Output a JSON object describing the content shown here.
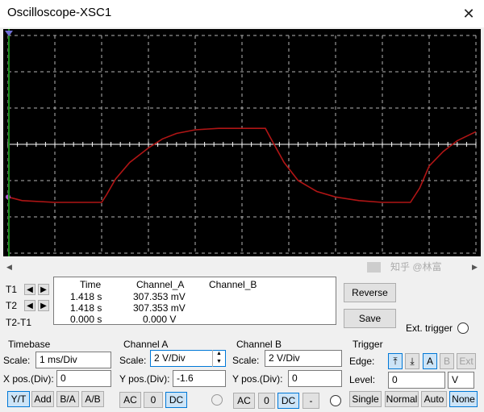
{
  "window": {
    "title": "Oscilloscope-XSC1",
    "close_glyph": "✕"
  },
  "scope": {
    "background": "#000000",
    "grid_color": "#b4b4b4",
    "trace_color": "#b01515",
    "cursor1_color": "#1a8c1a",
    "cursor2_color": "#6f6fd8",
    "divisions_x": 10,
    "divisions_y": 6,
    "volts_per_div": 2,
    "ypos_div": -1.6
  },
  "chart_data": {
    "type": "line",
    "xlim": [
      0,
      10
    ],
    "ylim": [
      -3,
      3
    ],
    "series": [
      {
        "x": [
          0,
          0.3,
          1,
          2,
          2.1,
          2.3,
          2.6,
          3.0,
          3.3,
          3.6,
          4.0,
          4.5,
          5.0,
          5.5,
          5.6,
          5.9,
          6.2,
          6.6,
          7.0,
          7.5,
          8.0,
          8.6,
          8.8,
          9.0,
          9.3,
          9.6,
          10
        ],
        "y": [
          -1.45,
          -1.55,
          -1.6,
          -1.6,
          -1.4,
          -0.95,
          -0.5,
          -0.1,
          0.15,
          0.3,
          0.4,
          0.44,
          0.44,
          0.44,
          0.2,
          -0.5,
          -1.0,
          -1.3,
          -1.45,
          -1.55,
          -1.6,
          -1.6,
          -1.2,
          -0.6,
          -0.2,
          0.1,
          0.35
        ]
      }
    ]
  },
  "readout": {
    "headers": {
      "time": "Time",
      "cha": "Channel_A",
      "chb": "Channel_B"
    },
    "rows": [
      {
        "label": "T1",
        "time": "1.418 s",
        "cha": "307.353 mV",
        "chb": ""
      },
      {
        "label": "T2",
        "time": "1.418 s",
        "cha": "307.353 mV",
        "chb": ""
      },
      {
        "label": "T2-T1",
        "time": "0.000 s",
        "cha": "0.000 V",
        "chb": ""
      }
    ]
  },
  "buttons": {
    "reverse": "Reverse",
    "save": "Save"
  },
  "ext_trigger": "Ext. trigger",
  "timebase": {
    "title": "Timebase",
    "scale_label": "Scale:",
    "scale": "1 ms/Div",
    "xpos_label": "X pos.(Div):",
    "xpos": "0",
    "modes": [
      "Y/T",
      "Add",
      "B/A",
      "A/B"
    ]
  },
  "channel_a": {
    "title": "Channel A",
    "scale_label": "Scale:",
    "scale": "2  V/Div",
    "ypos_label": "Y pos.(Div):",
    "ypos": "-1.6",
    "coupling": [
      "AC",
      "0",
      "DC"
    ]
  },
  "channel_b": {
    "title": "Channel B",
    "scale_label": "Scale:",
    "scale": "2  V/Div",
    "ypos_label": "Y pos.(Div):",
    "ypos": "0",
    "coupling": [
      "AC",
      "0",
      "DC",
      "-"
    ]
  },
  "trigger": {
    "title": "Trigger",
    "edge_label": "Edge:",
    "level_label": "Level:",
    "level": "0",
    "level_unit": "V",
    "edge_buttons": [
      "⤒",
      "⤓",
      "A",
      "B",
      "Ext"
    ],
    "modes": [
      "Single",
      "Normal",
      "Auto",
      "None"
    ]
  },
  "watermark": "知乎 @林富"
}
